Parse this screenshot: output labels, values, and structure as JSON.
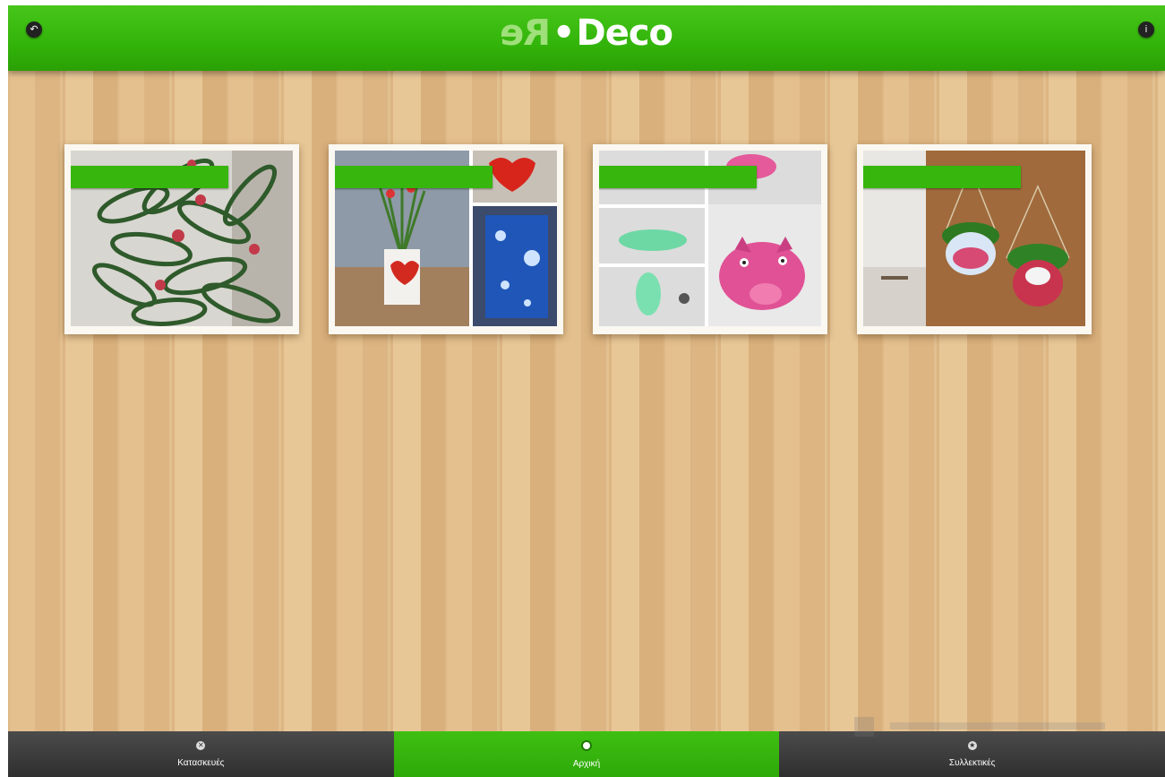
{
  "header": {
    "logo_re": "Re",
    "logo_dot": "•",
    "logo_deco": "Deco",
    "left_button_icon": "back-icon",
    "right_button_icon": "info-icon"
  },
  "colors": {
    "accent": "#37b60d",
    "tabbar": "#3a3a3a",
    "board": "#e2bd8a"
  },
  "cards": [
    {
      "ribbon": ""
    },
    {
      "ribbon": ""
    },
    {
      "ribbon": ""
    },
    {
      "ribbon": ""
    }
  ],
  "tabs": [
    {
      "label": "Κατασκευές",
      "icon": "tools-icon",
      "active": false
    },
    {
      "label": "Αρχική",
      "icon": "home-icon",
      "active": true
    },
    {
      "label": "Συλλεκτικές",
      "icon": "star-icon",
      "active": false
    }
  ]
}
